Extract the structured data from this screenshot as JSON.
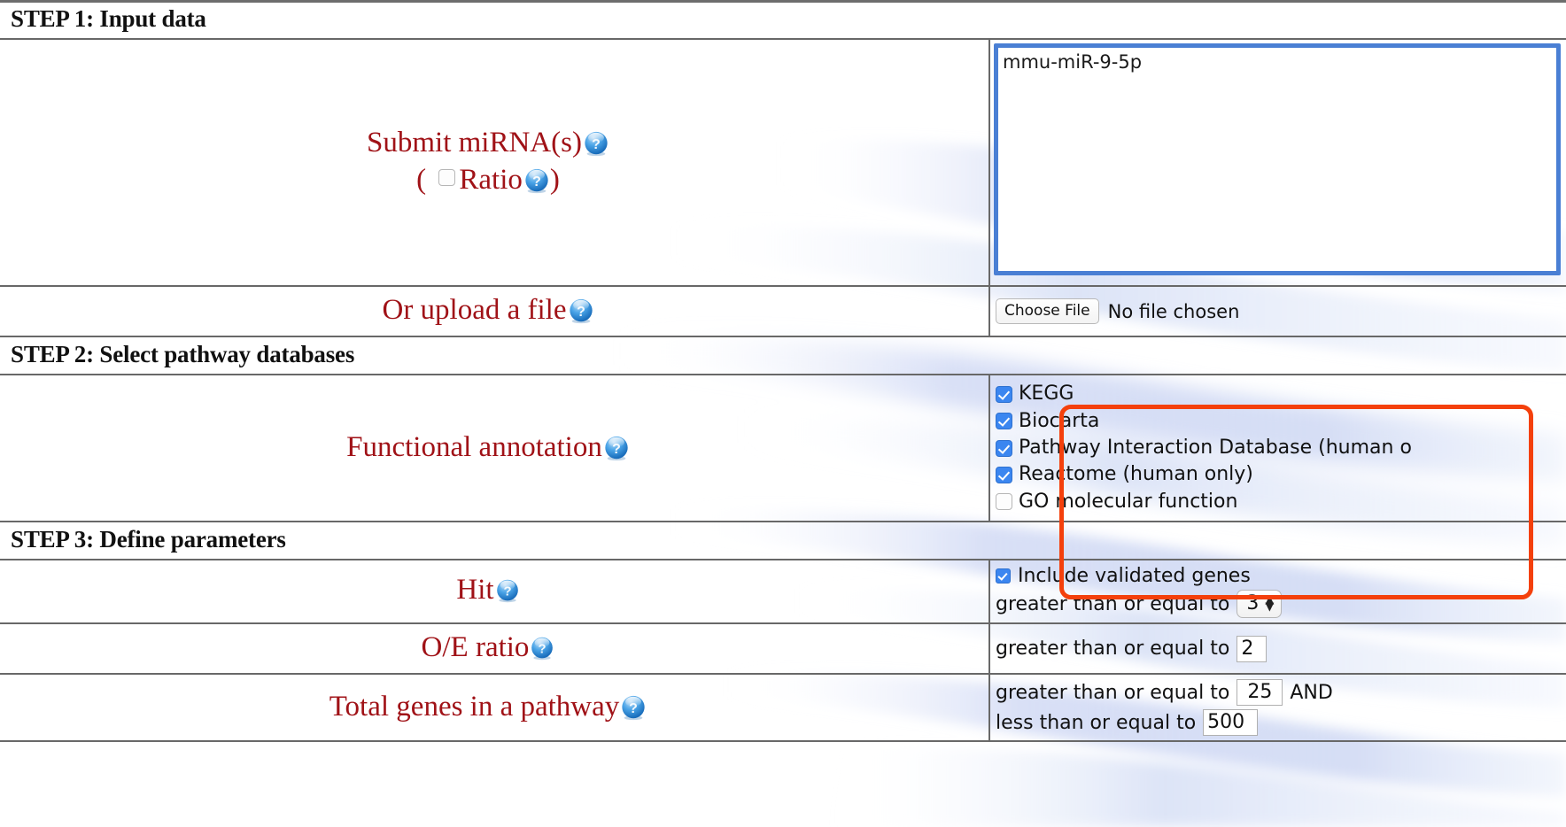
{
  "steps": {
    "step1": "STEP 1: Input data",
    "step2": "STEP 2: Select pathway databases",
    "step3": "STEP 3: Define parameters"
  },
  "labels": {
    "submit_mirna": "Submit miRNA(s)",
    "ratio_open": "(",
    "ratio": "Ratio",
    "ratio_close": ")",
    "upload_file": "Or upload a file",
    "functional_annotation": "Functional annotation",
    "hit": "Hit",
    "oe_ratio": "O/E ratio",
    "total_genes": "Total genes in a pathway"
  },
  "mirna_input": {
    "value": "mmu-miR-9-5p",
    "placeholder": ""
  },
  "ratio_checkbox": {
    "checked": false
  },
  "file_upload": {
    "button_label": "Choose File",
    "status": "No file chosen"
  },
  "databases": [
    {
      "label": "KEGG",
      "checked": true
    },
    {
      "label": "Biocarta",
      "checked": true
    },
    {
      "label": "Pathway Interaction Database (human o",
      "checked": true
    },
    {
      "label": "Reactome (human only)",
      "checked": true
    },
    {
      "label": "GO molecular function",
      "checked": false
    }
  ],
  "parameters": {
    "hit": {
      "include_validated_label": "Include validated genes",
      "include_validated_checked": true,
      "comparator": "greater than or equal to",
      "value": "3"
    },
    "oe_ratio": {
      "comparator": "greater than or equal to",
      "value": "2"
    },
    "total_genes": {
      "comparator_min": "greater than or equal to",
      "value_min": "25",
      "conjunction": "AND",
      "comparator_max": "less than or equal to",
      "value_max": "500"
    }
  },
  "icons": {
    "help": "help-question-icon"
  },
  "colors": {
    "label_red": "#a01217",
    "annotation_orange": "#f4400c",
    "checkbox_blue": "#3b86f0",
    "focus_blue": "#4a7fd4",
    "border_gray": "#686868"
  }
}
